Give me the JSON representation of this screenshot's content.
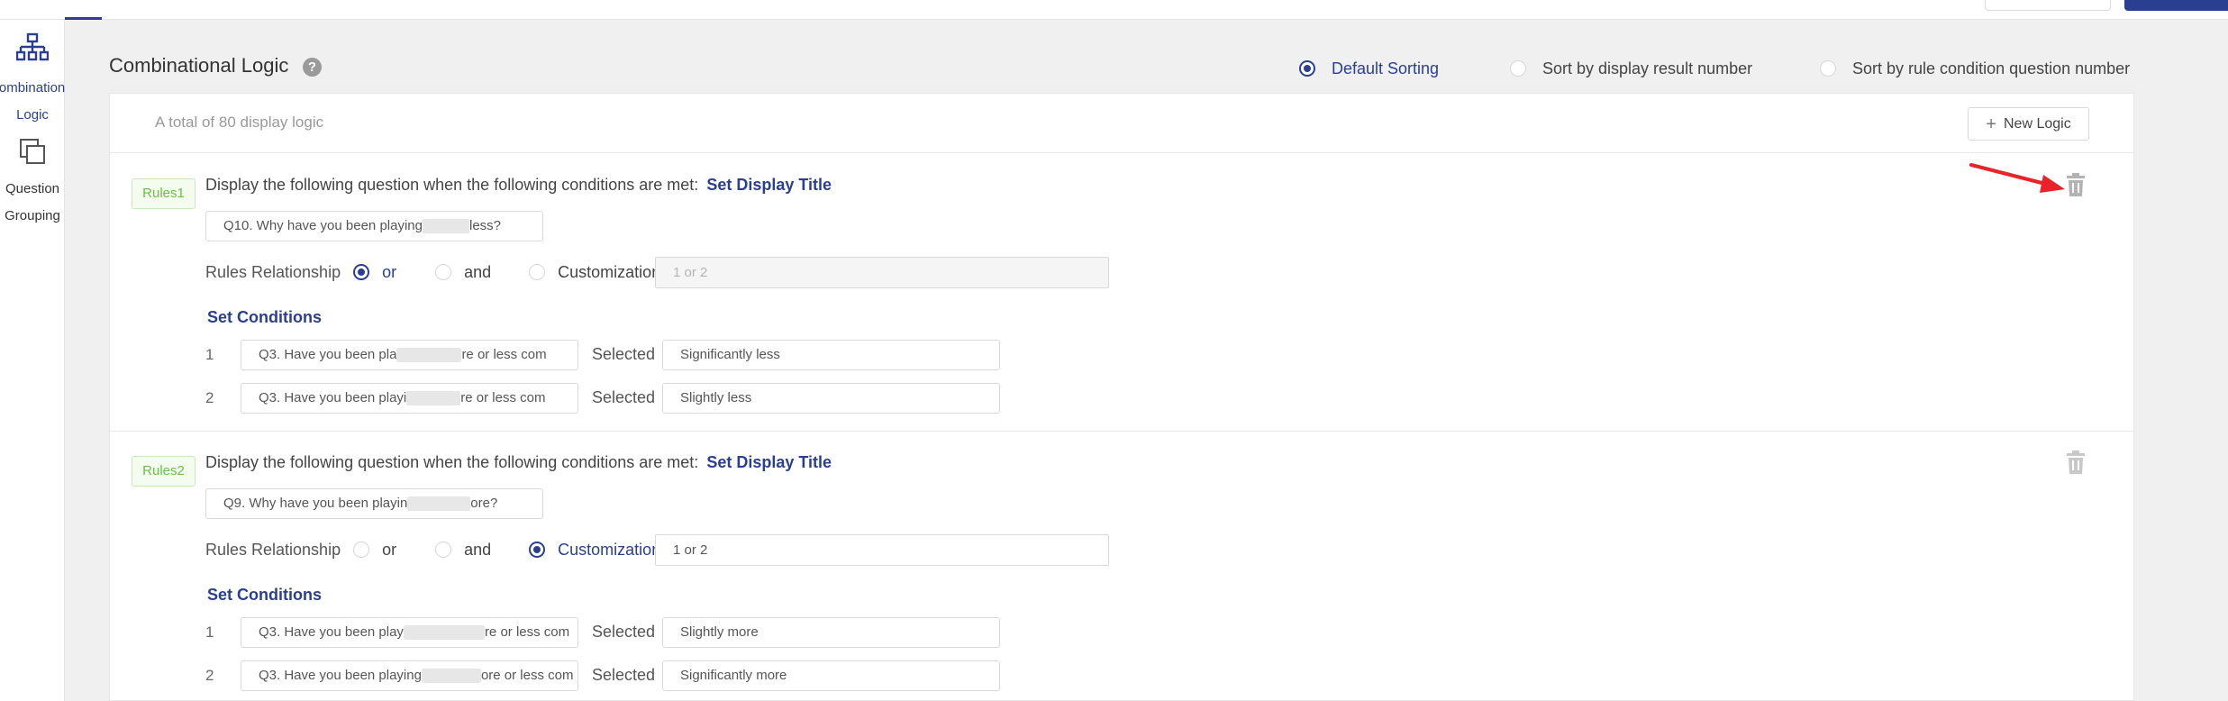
{
  "sidebar": {
    "items": [
      {
        "label_line1": "Combinational",
        "label_line2": "Logic",
        "icon": "sitemap-icon",
        "active": true
      },
      {
        "label_line1": "Question",
        "label_line2": "Grouping",
        "icon": "copy-icon",
        "active": false
      }
    ]
  },
  "header": {
    "title": "Combinational Logic",
    "help_glyph": "?",
    "sort_options": [
      {
        "label": "Default Sorting",
        "selected": true
      },
      {
        "label": "Sort by display result number",
        "selected": false
      },
      {
        "label": "Sort by rule condition question number",
        "selected": false
      }
    ]
  },
  "card": {
    "total_text": "A total of 80 display logic",
    "new_logic_label": "New Logic",
    "new_logic_glyph": "+"
  },
  "rules": [
    {
      "badge": "Rules1",
      "description": "Display the following question when the following conditions are met:",
      "set_title_link": "Set Display Title",
      "question_prefix": "Q10. Why have you been playing",
      "question_suffix": "less?",
      "relationship_label": "Rules Relationship",
      "relationship_options": [
        "or",
        "and",
        "Customization"
      ],
      "relationship_selected": "or",
      "custom_expression": "1 or 2",
      "set_conditions_label": "Set Conditions",
      "selected_label": "Selected",
      "conditions": [
        {
          "num": "1",
          "question_prefix": "Q3. Have you been pla",
          "question_suffix": "re or less com",
          "answer": "Significantly less"
        },
        {
          "num": "2",
          "question_prefix": "Q3. Have you been playi",
          "question_suffix": "re or less com",
          "answer": "Slightly less"
        }
      ]
    },
    {
      "badge": "Rules2",
      "description": "Display the following question when the following conditions are met:",
      "set_title_link": "Set Display Title",
      "question_prefix": "Q9. Why have you been playin",
      "question_suffix": "ore?",
      "relationship_label": "Rules Relationship",
      "relationship_options": [
        "or",
        "and",
        "Customization"
      ],
      "relationship_selected": "Customization",
      "custom_expression": "1 or 2",
      "set_conditions_label": "Set Conditions",
      "selected_label": "Selected",
      "conditions": [
        {
          "num": "1",
          "question_prefix": "Q3. Have you been play",
          "question_suffix": "re or less com",
          "answer": "Slightly more"
        },
        {
          "num": "2",
          "question_prefix": "Q3. Have you been playing",
          "question_suffix": "ore or less com",
          "answer": "Significantly more"
        }
      ]
    }
  ],
  "colors": {
    "accent": "#2a3f8f",
    "badge_green": "#6cbf45",
    "annotation_arrow": "#e8232a"
  }
}
